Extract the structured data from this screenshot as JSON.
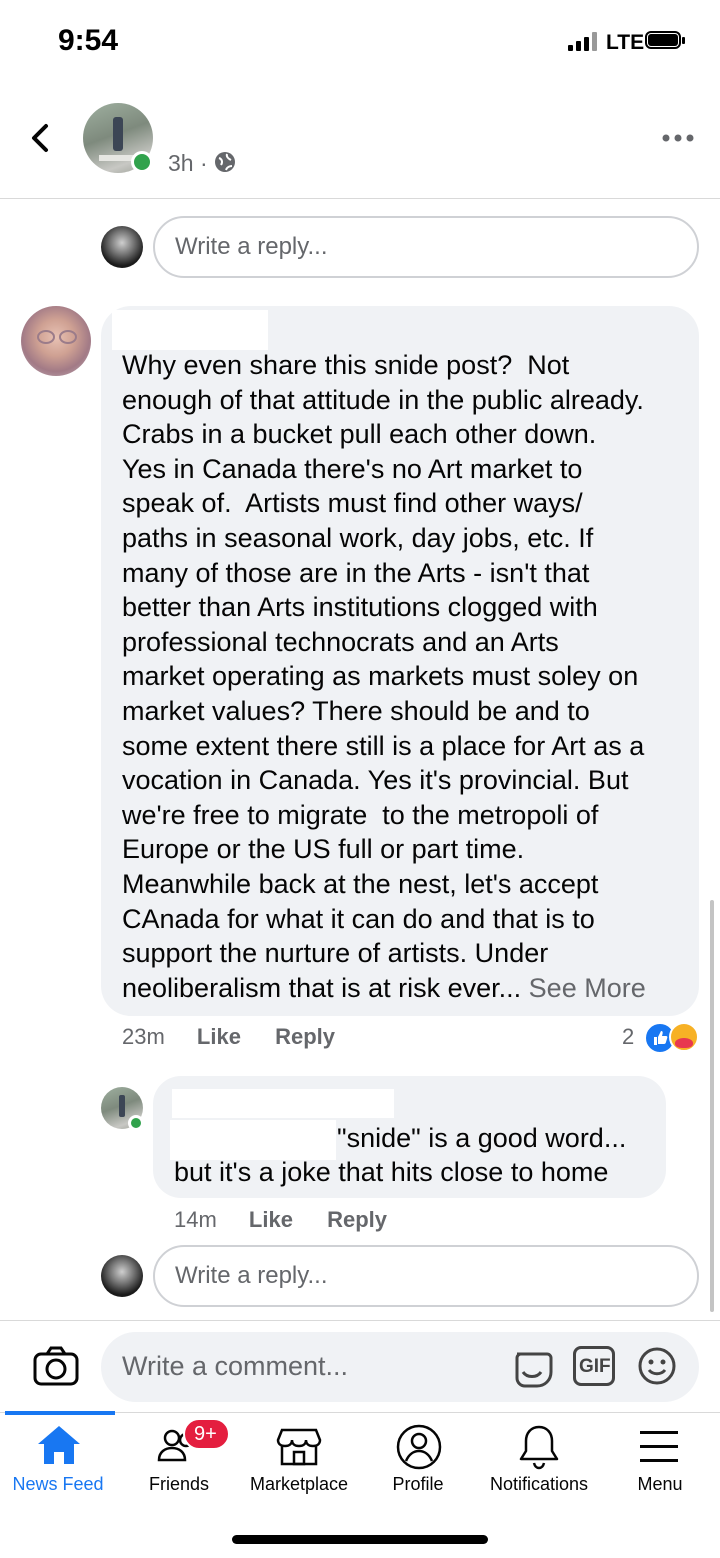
{
  "status": {
    "time": "9:54",
    "network": "LTE"
  },
  "header": {
    "time_ago": "3h",
    "separator": "·"
  },
  "top_reply_placeholder": "Write a reply...",
  "comment1": {
    "text": "Why even share this snide post?  Not\nenough of that attitude in the public already.\nCrabs in a bucket pull each other down.\nYes in Canada there's no Art market to\nspeak of.  Artists must find other ways/\npaths in seasonal work, day jobs, etc. If\nmany of those are in the Arts - isn't that\nbetter than Arts institutions clogged with\nprofessional technocrats and an Arts\nmarket operating as markets must soley on\nmarket values? There should be and to\nsome extent there still is a place for Art as a\nvocation in Canada. Yes it's provincial. But\nwe're free to migrate  to the metropoli of\nEurope or the US full or part time.\nMeanwhile back at the nest, let's accept\nCAnada for what it can do and that is to\nsupport the nurture of artists. Under\nneoliberalism that is at risk ever...",
    "see_more": " See More",
    "time_ago": "23m",
    "like": "Like",
    "reply": "Reply",
    "reaction_count": "2"
  },
  "reply1": {
    "text_line1": "\"snide\" is a good word...",
    "text_line2": "but it's a joke that hits close to home",
    "time_ago": "14m",
    "like": "Like",
    "reply": "Reply"
  },
  "bottom_reply_placeholder": "Write a reply...",
  "composer": {
    "placeholder": "Write a comment...",
    "gif_label": "GIF"
  },
  "nav": {
    "items": [
      {
        "label": "News Feed",
        "active": true
      },
      {
        "label": "Friends",
        "badge": "9+"
      },
      {
        "label": "Marketplace"
      },
      {
        "label": "Profile"
      },
      {
        "label": "Notifications"
      },
      {
        "label": "Menu"
      }
    ]
  },
  "colors": {
    "accent": "#1877f2",
    "badge": "#e41e3f",
    "online": "#31a24c",
    "bubble": "#f0f2f5"
  }
}
